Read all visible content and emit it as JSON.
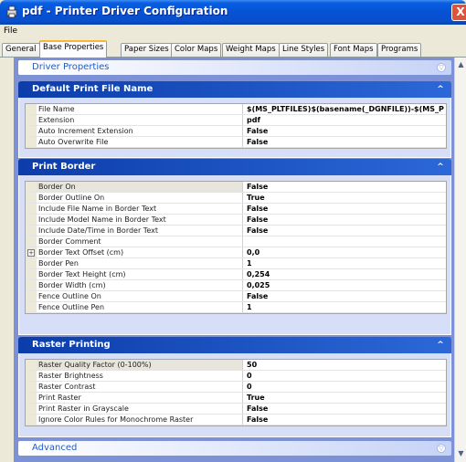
{
  "window": {
    "title": "pdf - Printer Driver Configuration",
    "close_label": "X",
    "app_icon": "printer-icon"
  },
  "menu": {
    "file": "File"
  },
  "tabs": [
    "General",
    "Base Properties",
    "Paper Sizes",
    "Color Maps",
    "Weight Maps",
    "Line Styles",
    "Font Maps",
    "Programs"
  ],
  "active_tab": "Base Properties",
  "collapsed_top": {
    "title": "Driver Properties",
    "chevron": "▽"
  },
  "default_print_file_name": {
    "title": "Default Print File Name",
    "chevron": "^",
    "rows": [
      {
        "name": "File Name",
        "value": "$(MS_PLTFILES)$(basename(_DGNFILE))-$(MS_P"
      },
      {
        "name": "Extension",
        "value": "pdf"
      },
      {
        "name": "Auto Increment Extension",
        "value": "False"
      },
      {
        "name": "Auto Overwrite File",
        "value": "False"
      }
    ]
  },
  "print_border": {
    "title": "Print Border",
    "chevron": "^",
    "rows": [
      {
        "name": "Border On",
        "value": "False"
      },
      {
        "name": "Border Outline On",
        "value": "True"
      },
      {
        "name": "Include File Name in Border Text",
        "value": "False"
      },
      {
        "name": "Include Model Name in Border Text",
        "value": "False"
      },
      {
        "name": "Include Date/Time in Border Text",
        "value": "False"
      },
      {
        "name": "Border Comment",
        "value": ""
      },
      {
        "name": "Border Text Offset (cm)",
        "value": "0,0",
        "expander": "+"
      },
      {
        "name": "Border Pen",
        "value": "1"
      },
      {
        "name": "Border Text Height (cm)",
        "value": "0,254"
      },
      {
        "name": "Border Width (cm)",
        "value": "0,025"
      },
      {
        "name": "Fence Outline On",
        "value": "False"
      },
      {
        "name": "Fence Outline Pen",
        "value": "1"
      }
    ]
  },
  "raster_printing": {
    "title": "Raster Printing",
    "chevron": "^",
    "rows": [
      {
        "name": "Raster Quality Factor (0-100%)",
        "value": "50"
      },
      {
        "name": "Raster Brightness",
        "value": "0"
      },
      {
        "name": "Raster Contrast",
        "value": "0"
      },
      {
        "name": "Print Raster",
        "value": "True"
      },
      {
        "name": "Print Raster in Grayscale",
        "value": "False"
      },
      {
        "name": "Ignore Color Rules for Monochrome Raster",
        "value": "False"
      }
    ]
  },
  "collapsed_bottom": {
    "title": "Advanced",
    "chevron": "▽"
  },
  "scrollbar": {
    "up": "▲",
    "down": "▼"
  },
  "colors": {
    "titlebar": "#0552d6",
    "panel_header": "#0c3daa",
    "content_bg": "#7c91d6",
    "active_tab_accent": "#fbb535"
  }
}
